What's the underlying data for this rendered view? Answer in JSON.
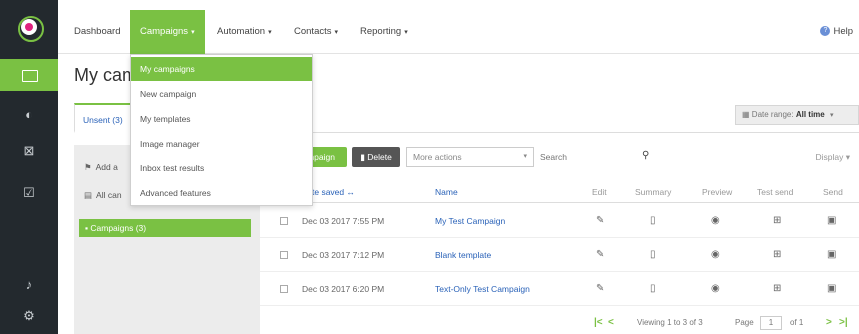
{
  "nav": {
    "items": [
      {
        "label": "Dashboard"
      },
      {
        "label": "Campaigns",
        "caret": "▾"
      },
      {
        "label": "Automation",
        "caret": "▾"
      },
      {
        "label": "Contacts",
        "caret": "▾"
      },
      {
        "label": "Reporting",
        "caret": "▾"
      }
    ],
    "help_label": "Help"
  },
  "dropdown": {
    "items": [
      "My campaigns",
      "New campaign",
      "My templates",
      "Image manager",
      "Inbox test results",
      "Advanced features"
    ]
  },
  "page": {
    "title": "My cam",
    "tab_unsent": "Unsent (3)"
  },
  "date_range": {
    "label": "Date range:",
    "value": "All time",
    "caret": "▾"
  },
  "panel": {
    "add_label": "Add a",
    "all_label": "All can",
    "selected_folder": "Campaigns (3)"
  },
  "toolbar": {
    "new_campaign_label": "mpaign",
    "delete_label": "Delete",
    "more_actions_label": "More actions",
    "search_placeholder": "Search",
    "display_label": "Display"
  },
  "table": {
    "headers": {
      "date": "te saved",
      "name": "Name",
      "edit": "Edit",
      "summary": "Summary",
      "preview": "Preview",
      "test_send": "Test send",
      "send": "Send"
    },
    "rows": [
      {
        "date": "Dec 03 2017 7:55 PM",
        "name": "My Test Campaign"
      },
      {
        "date": "Dec 03 2017 7:12 PM",
        "name": "Blank template"
      },
      {
        "date": "Dec 03 2017 6:20 PM",
        "name": "Text-Only Test Campaign"
      }
    ]
  },
  "footer": {
    "viewing": "Viewing 1 to 3 of 3",
    "page_label": "Page",
    "page_value": "1",
    "of_label": "of 1"
  },
  "colors": {
    "accent": "#7ac143",
    "rail": "#23292e",
    "link": "#2a62b8",
    "brand": "#e0237f"
  }
}
